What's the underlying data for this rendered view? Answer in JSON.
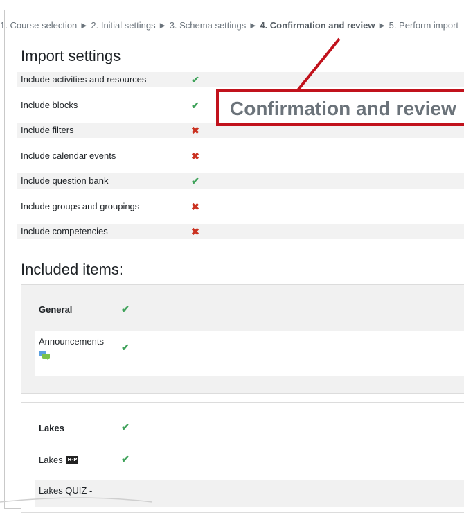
{
  "breadcrumb": {
    "step1": "1. Course selection",
    "sep1": " ► ",
    "step2": "2. Initial settings",
    "sep2": " ► ",
    "step3": "3. Schema settings",
    "sep3": " ► ",
    "step4": "4. Confirmation and review",
    "sep4": " ► ",
    "step5": "5. Perform import"
  },
  "import_settings": {
    "heading": "Import settings",
    "rows": [
      {
        "label": "Include activities and resources",
        "status": "yes"
      },
      {
        "label": "Include blocks",
        "status": "yes"
      },
      {
        "label": "Include filters",
        "status": "no"
      },
      {
        "label": "Include calendar events",
        "status": "no"
      },
      {
        "label": "Include question bank",
        "status": "yes"
      },
      {
        "label": "Include groups and groupings",
        "status": "no"
      },
      {
        "label": "Include competencies",
        "status": "no"
      }
    ]
  },
  "included_items": {
    "heading": "Included items:",
    "sections": [
      {
        "name": "General",
        "items": [
          {
            "label": "Announcements",
            "icon": "forum-icon"
          }
        ]
      },
      {
        "name": "Lakes",
        "items": [
          {
            "label": "Lakes",
            "icon": "h5p-icon"
          },
          {
            "label": "Lakes QUIZ -"
          }
        ]
      }
    ]
  },
  "icons": {
    "check": "✔",
    "cross": "✖",
    "h5p": "H-P"
  },
  "callout": {
    "text": "Confirmation and review",
    "color": "#c1121c"
  }
}
